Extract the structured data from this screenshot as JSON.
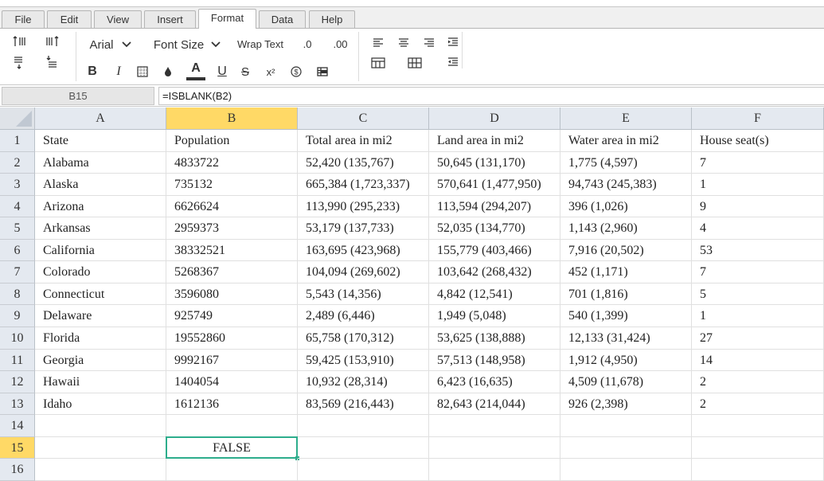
{
  "menu": {
    "tabs": [
      {
        "label": "File"
      },
      {
        "label": "Edit"
      },
      {
        "label": "View"
      },
      {
        "label": "Insert"
      },
      {
        "label": "Format"
      },
      {
        "label": "Data"
      },
      {
        "label": "Help"
      }
    ],
    "active_tab": "Format"
  },
  "toolbar": {
    "font_name": "Arial",
    "font_size": "Font Size",
    "wrap_text": "Wrap Text",
    "decrease_decimal": ".0",
    "increase_decimal": ".00",
    "bold": "B",
    "italic": "I",
    "font_color": "A",
    "underline": "U",
    "strikethrough": "S",
    "superscript": "x²",
    "accent_color": "#2dad8c",
    "highlight_color": "#ffd966"
  },
  "formula_bar": {
    "cell_ref": "B15",
    "formula": "=ISBLANK(B2)"
  },
  "sheet": {
    "columns": [
      "A",
      "B",
      "C",
      "D",
      "E",
      "F"
    ],
    "rows": [
      "1",
      "2",
      "3",
      "4",
      "5",
      "6",
      "7",
      "8",
      "9",
      "10",
      "11",
      "12",
      "13",
      "14",
      "15",
      "16"
    ],
    "selected_cell": {
      "col": "B",
      "row": "15",
      "value": "FALSE"
    },
    "cells": [
      [
        "State",
        "Population",
        "Total area in mi2",
        "Land area in mi2",
        "Water area in mi2",
        "House seat(s)"
      ],
      [
        "Alabama",
        "4833722",
        "52,420 (135,767)",
        "50,645 (131,170)",
        "1,775 (4,597)",
        "7"
      ],
      [
        "Alaska",
        "735132",
        "665,384 (1,723,337)",
        "570,641 (1,477,950)",
        "94,743 (245,383)",
        "1"
      ],
      [
        "Arizona",
        "6626624",
        "113,990 (295,233)",
        "113,594 (294,207)",
        "396 (1,026)",
        "9"
      ],
      [
        "Arkansas",
        "2959373",
        "53,179 (137,733)",
        "52,035 (134,770)",
        "1,143 (2,960)",
        "4"
      ],
      [
        "California",
        "38332521",
        "163,695 (423,968)",
        "155,779 (403,466)",
        "7,916 (20,502)",
        "53"
      ],
      [
        "Colorado",
        "5268367",
        "104,094 (269,602)",
        "103,642 (268,432)",
        "452 (1,171)",
        "7"
      ],
      [
        "Connecticut",
        "3596080",
        "5,543 (14,356)",
        "4,842 (12,541)",
        "701 (1,816)",
        "5"
      ],
      [
        "Delaware",
        "925749",
        "2,489 (6,446)",
        "1,949 (5,048)",
        "540 (1,399)",
        "1"
      ],
      [
        "Florida",
        "19552860",
        "65,758 (170,312)",
        "53,625 (138,888)",
        "12,133 (31,424)",
        "27"
      ],
      [
        "Georgia",
        "9992167",
        "59,425 (153,910)",
        "57,513 (148,958)",
        "1,912 (4,950)",
        "14"
      ],
      [
        "Hawaii",
        "1404054",
        "10,932 (28,314)",
        "6,423 (16,635)",
        "4,509 (11,678)",
        "2"
      ],
      [
        "Idaho",
        "1612136",
        "83,569 (216,443)",
        "82,643 (214,044)",
        "926 (2,398)",
        "2"
      ],
      [
        "",
        "",
        "",
        "",
        "",
        ""
      ],
      [
        "",
        "FALSE",
        "",
        "",
        "",
        ""
      ],
      [
        "",
        "",
        "",
        "",
        "",
        ""
      ]
    ]
  }
}
